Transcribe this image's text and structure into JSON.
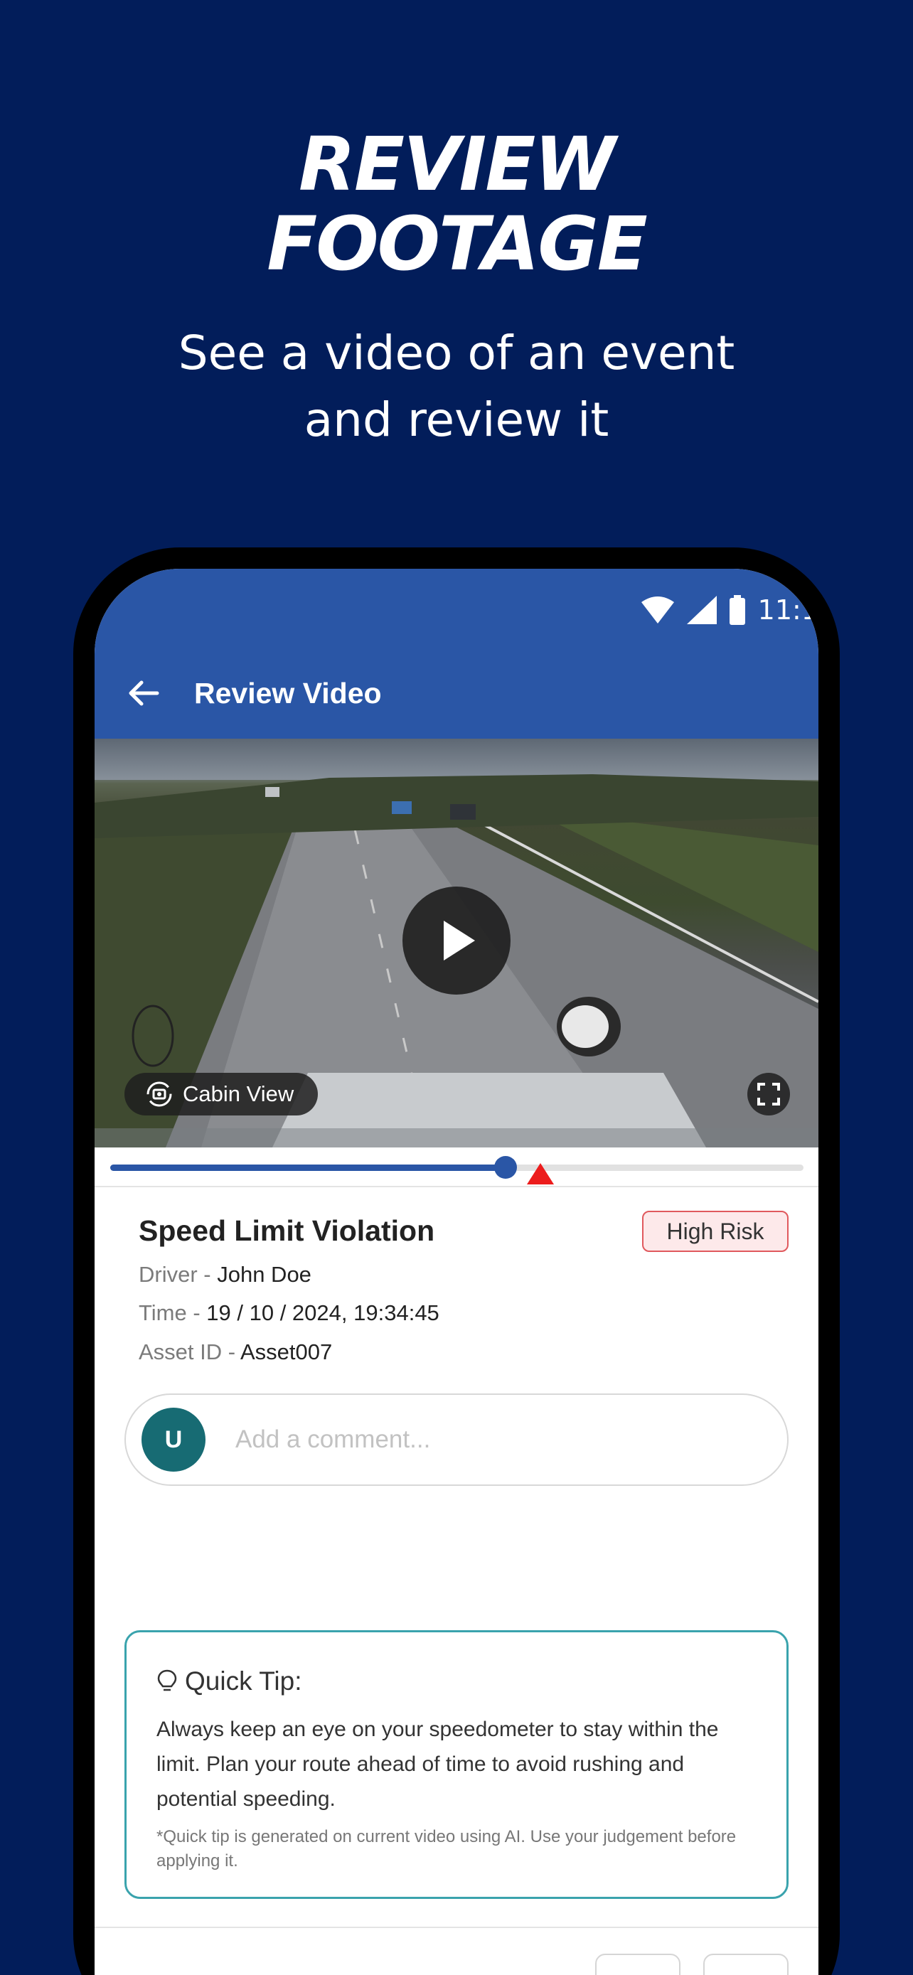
{
  "promo": {
    "title_line1": "REVIEW",
    "title_line2": "FOOTAGE",
    "subtitle_line1": "See a video of an event",
    "subtitle_line2": "and review it"
  },
  "status_bar": {
    "time": "11:1",
    "icons": [
      "wifi-icon",
      "signal-icon",
      "battery-icon"
    ]
  },
  "app_bar": {
    "title": "Review Video",
    "back_icon": "arrow-left-icon"
  },
  "video": {
    "cabin_view_label": "Cabin View",
    "play_icon": "play-icon",
    "fullscreen_icon": "fullscreen-icon",
    "progress": 0.57,
    "event_marker_position": 0.62
  },
  "event": {
    "title": "Speed Limit Violation",
    "risk_label": "High Risk",
    "driver_label": "Driver - ",
    "driver_value": "John Doe",
    "time_label": "Time - ",
    "time_value": "19 / 10 / 2024, 19:34:45",
    "asset_label": "Asset ID - ",
    "asset_value": "Asset007"
  },
  "comment": {
    "avatar_initial": "U",
    "placeholder": "Add a comment..."
  },
  "quick_tip": {
    "heading": "Quick Tip:",
    "icon": "lightbulb-icon",
    "body": "Always keep an eye on your speedometer to stay within the limit. Plan your route ahead of time to avoid rushing and potential speeding.",
    "note": "*Quick tip is generated on current video using AI. Use your judgement before applying it."
  },
  "colors": {
    "background": "#021d5a",
    "app_bar": "#2a56a6",
    "risk_border": "#e0595d",
    "risk_fill": "#fde9ea",
    "avatar": "#176b73",
    "tip_border": "#3aa3ad",
    "event_marker": "#ec1c1c"
  }
}
